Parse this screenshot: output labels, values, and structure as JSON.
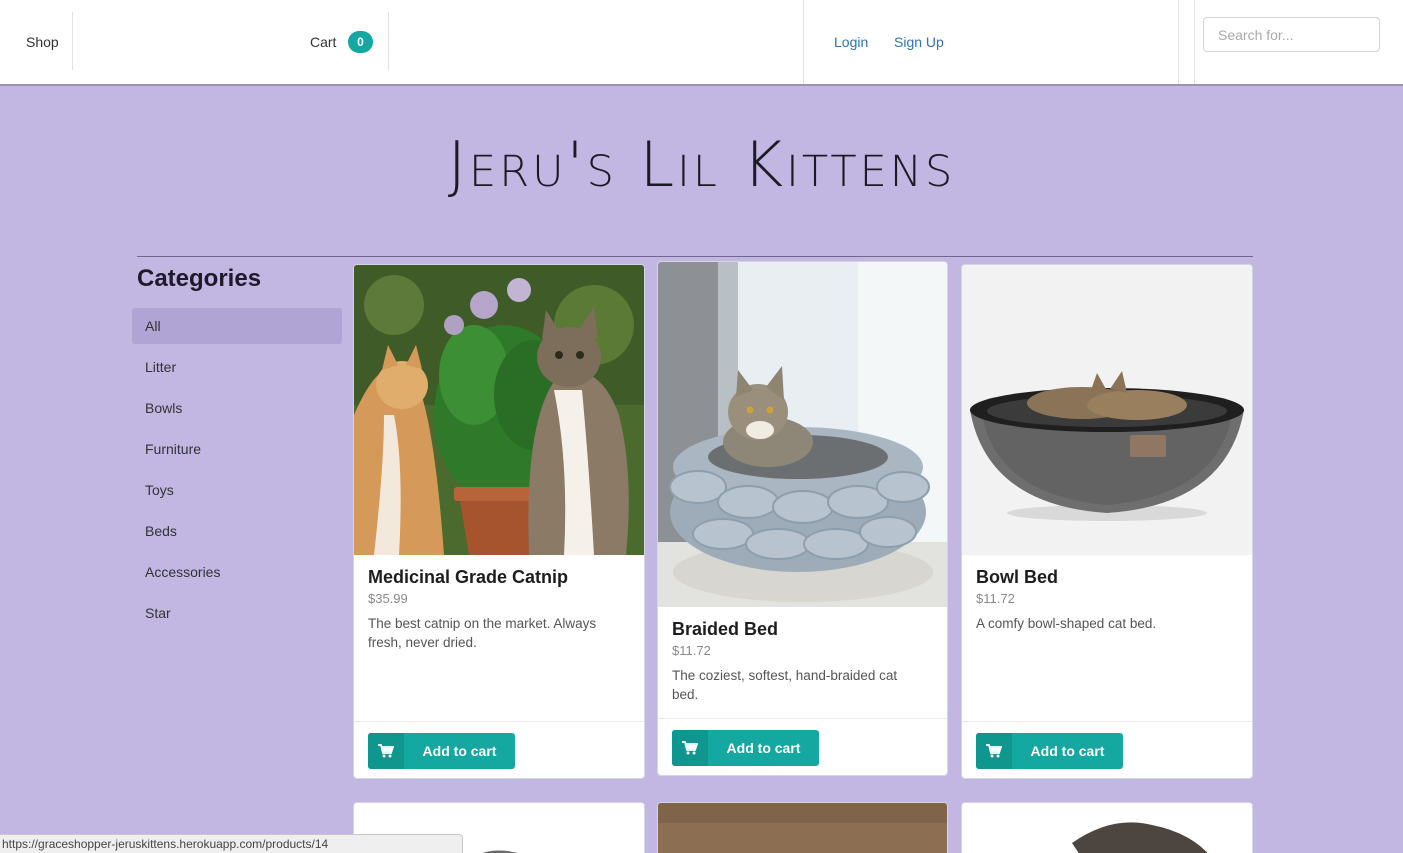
{
  "nav": {
    "shop": "Shop",
    "cart": "Cart",
    "cart_count": "0",
    "login": "Login",
    "signup": "Sign Up",
    "search_placeholder": "Search for..."
  },
  "hero": {
    "title": "Jeru's Lil Kittens"
  },
  "sidebar": {
    "heading": "Categories",
    "items": [
      {
        "label": "All",
        "active": true
      },
      {
        "label": "Litter"
      },
      {
        "label": "Bowls"
      },
      {
        "label": "Furniture"
      },
      {
        "label": "Toys"
      },
      {
        "label": "Beds"
      },
      {
        "label": "Accessories"
      },
      {
        "label": "Star"
      }
    ]
  },
  "products": [
    {
      "name": "Medicinal Grade Catnip",
      "price": "$35.99",
      "description": "The best catnip on the market. Always fresh, never dried.",
      "button": "Add to cart"
    },
    {
      "name": "Braided Bed",
      "price": "$11.72",
      "description": "The coziest, softest, hand-braided cat bed.",
      "button": "Add to cart"
    },
    {
      "name": "Bowl Bed",
      "price": "$11.72",
      "description": "A comfy bowl-shaped cat bed.",
      "button": "Add to cart"
    }
  ],
  "status_bar": {
    "url": "https://graceshopper-jeruskittens.herokuapp.com/products/14"
  },
  "colors": {
    "accent": "#14a8a0",
    "background": "#c2b6e3",
    "link": "#2e72b8"
  }
}
